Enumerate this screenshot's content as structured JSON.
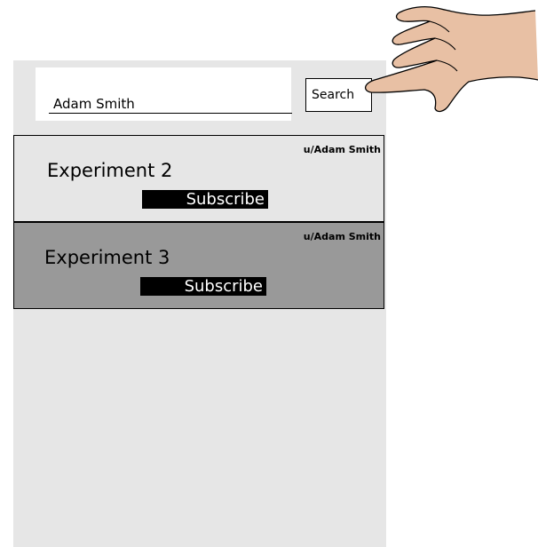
{
  "search": {
    "query": "Adam Smith",
    "button_label": "Search"
  },
  "results": [
    {
      "user": "u/Adam Smith",
      "title": "Experiment 2",
      "subscribe_label": "Subscribe",
      "highlighted": false
    },
    {
      "user": "u/Adam Smith",
      "title": "Experiment 3",
      "subscribe_label": "Subscribe",
      "highlighted": true
    }
  ],
  "colors": {
    "panel": "#e6e6e6",
    "highlight": "#999999",
    "hand": "#e8c0a4"
  },
  "overlay": {
    "pointer": "pointing-hand-icon"
  }
}
